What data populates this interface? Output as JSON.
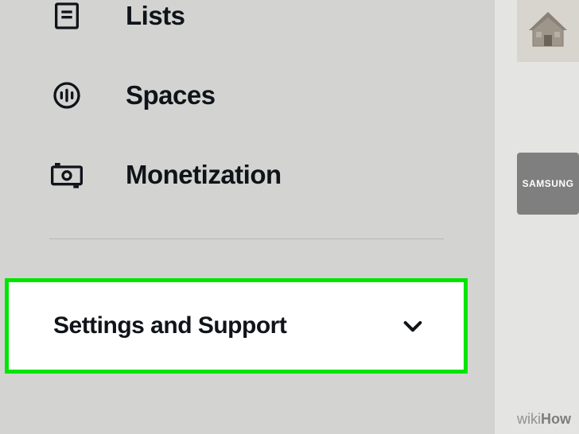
{
  "nav": {
    "lists": {
      "label": "Lists"
    },
    "spaces": {
      "label": "Spaces"
    },
    "monetization": {
      "label": "Monetization"
    }
  },
  "settings": {
    "label": "Settings and Support"
  },
  "thumbnails": {
    "samsung": {
      "label": "SAMSUNG"
    }
  },
  "watermark": {
    "wiki": "wiki",
    "how": "How"
  }
}
